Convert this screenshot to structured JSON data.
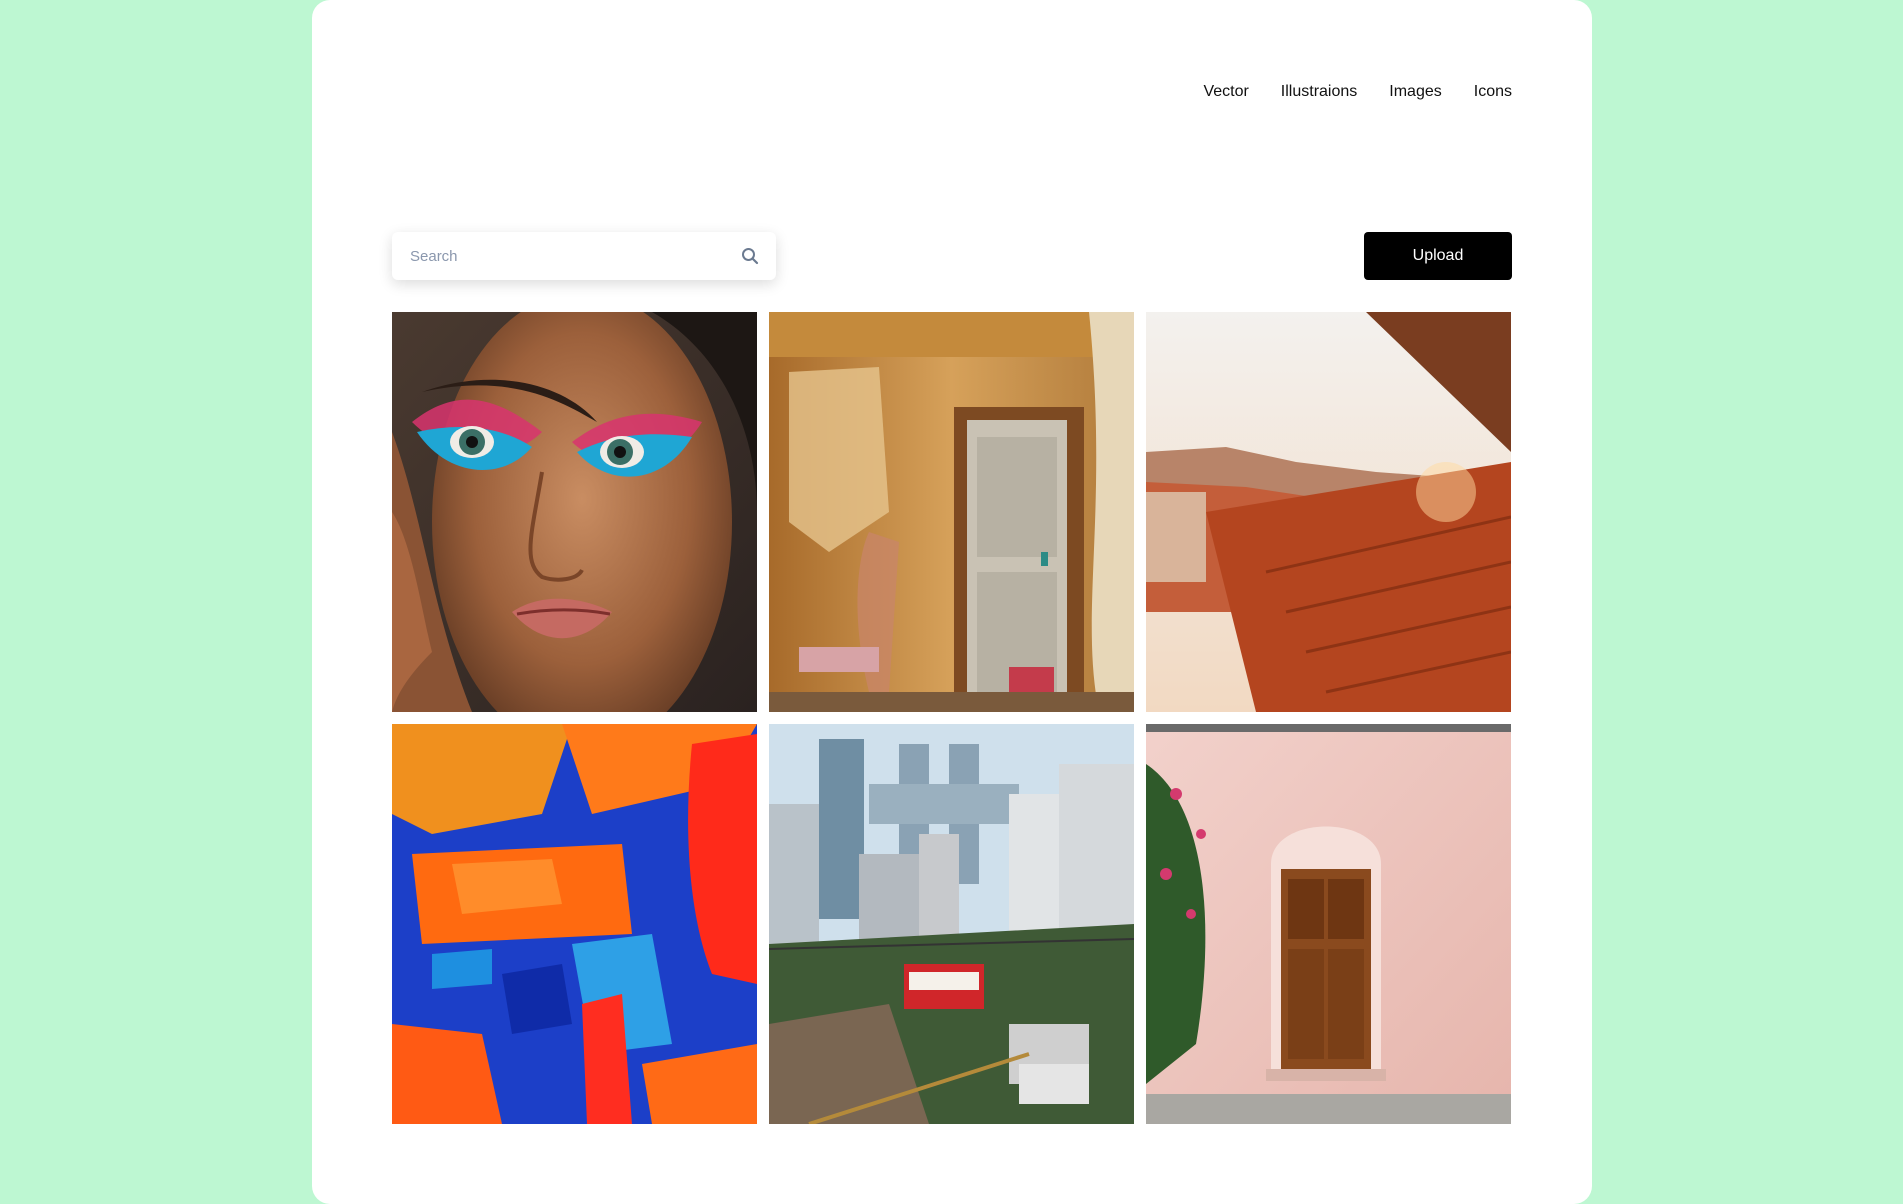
{
  "nav": {
    "items": [
      {
        "label": "Vector"
      },
      {
        "label": "Illustraions"
      },
      {
        "label": "Images"
      },
      {
        "label": "Icons"
      }
    ]
  },
  "search": {
    "placeholder": "Search",
    "value": "",
    "icon": "search-icon"
  },
  "upload": {
    "label": "Upload"
  },
  "gallery": {
    "images": [
      {
        "subject": "portrait"
      },
      {
        "subject": "old-door"
      },
      {
        "subject": "rooftops"
      },
      {
        "subject": "abstract-paint"
      },
      {
        "subject": "city-cable-car"
      },
      {
        "subject": "wooden-door"
      }
    ]
  },
  "colors": {
    "background": "#bdf7d2",
    "card": "#ffffff",
    "button": "#000000",
    "placeholder": "#8a97ad"
  }
}
